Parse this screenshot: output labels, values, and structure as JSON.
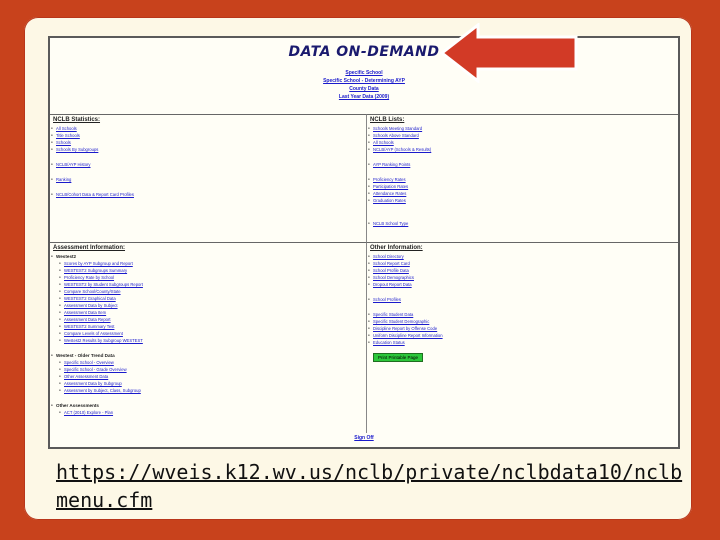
{
  "page": {
    "title": "DATA ON-DEMAND",
    "header_lines": [
      "Specific School",
      "Specific School - Determining AYP",
      "County Data",
      "Last Year Data (2009)"
    ],
    "sign_off": "Sign Off"
  },
  "nclb_statistics": {
    "heading": "NCLB Statistics:",
    "items": [
      "All Schools",
      "Title Schools",
      "Schools",
      "Schools By Subgroups",
      "",
      "NCLB/AYP History",
      "",
      "Ranking",
      "",
      "NCLB/Cohort Data & Report Card Profiles"
    ]
  },
  "nclb_lists": {
    "heading": "NCLB Lists:",
    "items": [
      "Schools Meeting Standard",
      "Schools Above Standard",
      "All Schools",
      "NCLB/AYP (Schools & Results)",
      "",
      "AYP Ranking Points",
      "",
      "Proficiency Rates",
      "Participation Rates",
      "Attendance Rates",
      "Graduation Rates",
      "",
      "",
      "NCLB School Type"
    ]
  },
  "assessment": {
    "heading": "Assessment Information:",
    "group1": "Westest2",
    "group1_items": [
      "Scores by AYP Subgroup and Report",
      "WESTEST2 Subgroups Summary",
      "Proficiency Rate by School",
      "WESTEST2 by Student Subgroups Report",
      "Compare School/County/State",
      "WESTEST2 Graphical Data",
      "Assessment Data by Subject",
      "Assessment Data Item",
      "Assessment Data Report",
      "WESTEST2 Summary Test",
      "Compare Levels of Assessment",
      "Westest2 Results by Subgroup WESTEST"
    ],
    "group2": "Westest - Older Trend Data",
    "group2_items": [
      "Specific School - Overview",
      "Specific School - Grade Overview",
      "Other Assessment Data",
      "Assessment Data by Subgroup",
      "Assessment by Subject, Class, Subgroup"
    ],
    "group3": "Other Assessments",
    "group3_items": [
      "ACT (2010) Explore - Plan"
    ]
  },
  "other": {
    "heading": "Other Information:",
    "items": [
      "School Directory",
      "School Report Card",
      "School Profile Data",
      "School Demographics",
      "Dropout Report Data",
      "",
      "School Profiles",
      "",
      "Specific Student Data",
      "Specific Student Demographic",
      "Discipline Report by Offense Code",
      "Uniform Discipline Report Information",
      "Education Status"
    ],
    "button_label": "Print Printable Page"
  },
  "url_text": "https://wveis.k12.wv.us/nclb/private/nclbdata10/nclbmenu.cfm",
  "colors": {
    "background": "#c8421c",
    "slide": "#fdf8e6",
    "arrow": "#d23a26",
    "link": "#1a1acc"
  }
}
